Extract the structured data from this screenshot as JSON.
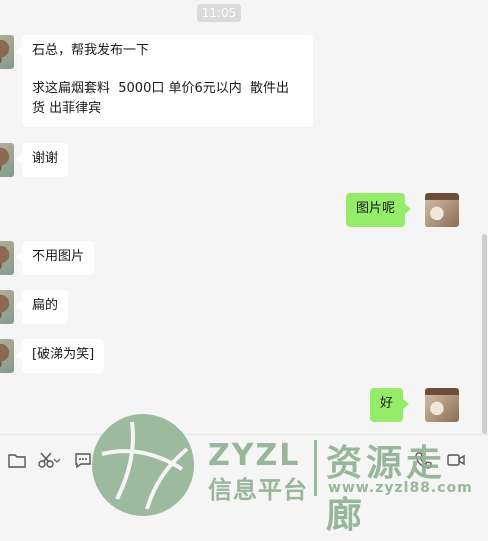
{
  "timestamp": "11:05",
  "messages": [
    {
      "side": "in",
      "lines": [
        "石总，帮我发布一下",
        "",
        "求这扁烟套料  5000口 单价6元以内  散件出",
        "货 出菲律宾"
      ]
    },
    {
      "side": "in",
      "lines": [
        "谢谢"
      ]
    },
    {
      "side": "out",
      "lines": [
        "图片呢"
      ]
    },
    {
      "side": "in",
      "lines": [
        "不用图片"
      ]
    },
    {
      "side": "in",
      "lines": [
        "扁的"
      ]
    },
    {
      "side": "in",
      "lines": [
        "[破涕为笑]"
      ]
    },
    {
      "side": "out",
      "lines": [
        "好"
      ]
    }
  ],
  "toolbar": {
    "icons": [
      "folder-icon",
      "scissors-icon",
      "dropdown-arrow-icon",
      "chat-bubble-icon",
      "phone-icon",
      "video-icon"
    ]
  },
  "watermark": {
    "brand": "ZYZL",
    "subtitle": "信息平台",
    "title": "资源走廊",
    "url": "www.zyzl88.com"
  },
  "colors": {
    "outgoing_bubble": "#95ec69",
    "incoming_bubble": "#ffffff",
    "background": "#f5f5f5",
    "watermark": "#8fb090"
  }
}
